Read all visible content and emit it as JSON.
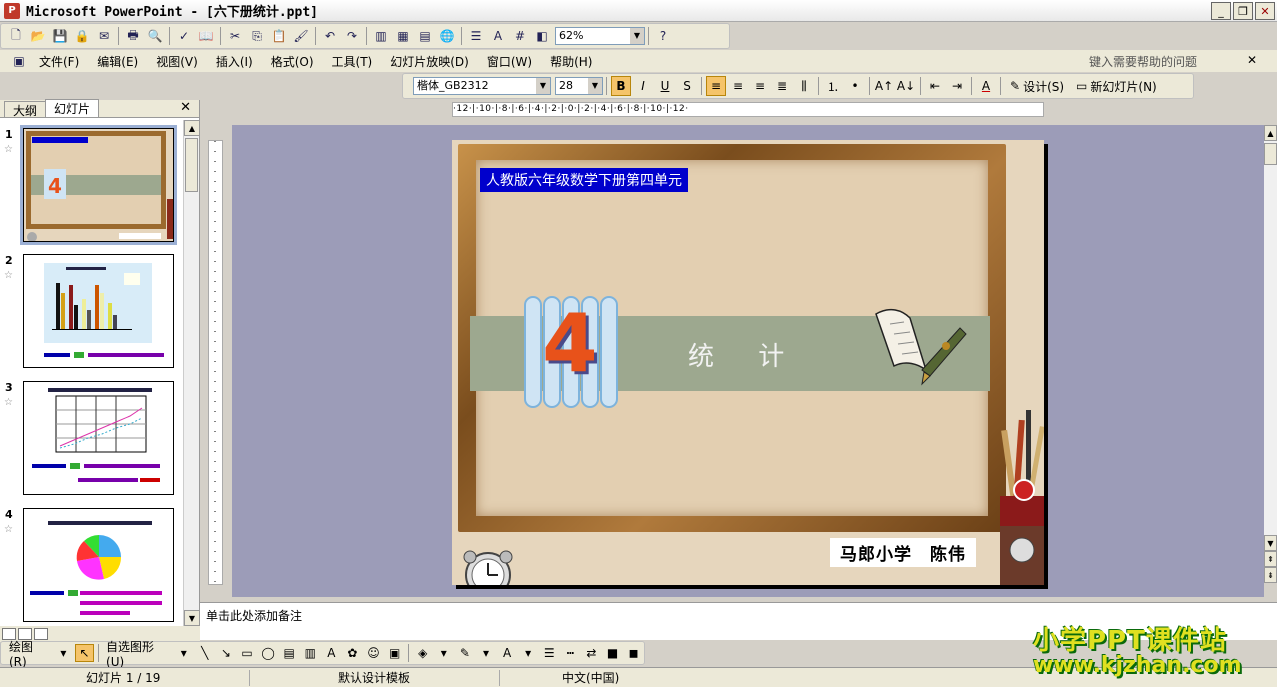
{
  "window": {
    "title": "Microsoft PowerPoint - [六下册统计.ppt]"
  },
  "toolbar": {
    "zoom": "62%"
  },
  "menu": {
    "items": [
      "文件(F)",
      "编辑(E)",
      "视图(V)",
      "插入(I)",
      "格式(O)",
      "工具(T)",
      "幻灯片放映(D)",
      "窗口(W)",
      "帮助(H)"
    ],
    "help_placeholder": "键入需要帮助的问题"
  },
  "format": {
    "font": "楷体_GB2312",
    "size": "28",
    "design_label": "设计(S)",
    "new_slide_label": "新幻灯片(N)"
  },
  "pane": {
    "tab_outline": "大纲",
    "tab_slides": "幻灯片",
    "slide_numbers": [
      "1",
      "2",
      "3",
      "4"
    ]
  },
  "ruler": {
    "h_text": "·12·|·10·|·8·|·6·|·4·|·2·|·0·|·2·|·4·|·6·|·8·|·10·|·12·"
  },
  "slide": {
    "banner": "人教版六年级数学下册第四单元",
    "unit_number": "4",
    "topic": "统 计",
    "author": "马郎小学　陈伟"
  },
  "notes": {
    "placeholder": "单击此处添加备注"
  },
  "drawing": {
    "draw_label": "绘图(R)",
    "autoshape_label": "自选图形(U)"
  },
  "status": {
    "slide_pos": "幻灯片 1 / 19",
    "template": "默认设计模板",
    "language": "中文(中国)"
  },
  "watermark": {
    "line1": "小学PPT课件站",
    "line2": "www.kjzhan.com"
  },
  "colors": {
    "banner_bg": "#0000cc",
    "band": "#9da88f",
    "number": "#e8521a"
  }
}
